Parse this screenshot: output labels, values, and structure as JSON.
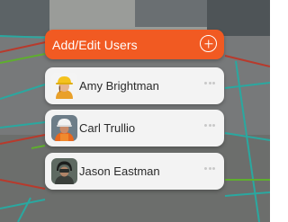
{
  "panel": {
    "title": "Add/Edit Users",
    "add_icon": "plus-circle-icon",
    "accent_color": "#f15a22"
  },
  "users": [
    {
      "name": "Amy Brightman",
      "avatar_icon": "worker-yellow-hardhat-avatar",
      "more_icon": "ellipsis-icon"
    },
    {
      "name": "Carl Trullio",
      "avatar_icon": "worker-white-hardhat-avatar",
      "more_icon": "ellipsis-icon"
    },
    {
      "name": "Jason Eastman",
      "avatar_icon": "worker-black-helmet-avatar",
      "more_icon": "ellipsis-icon"
    }
  ],
  "background": {
    "description_icon": "construction-site-ar-scene"
  }
}
